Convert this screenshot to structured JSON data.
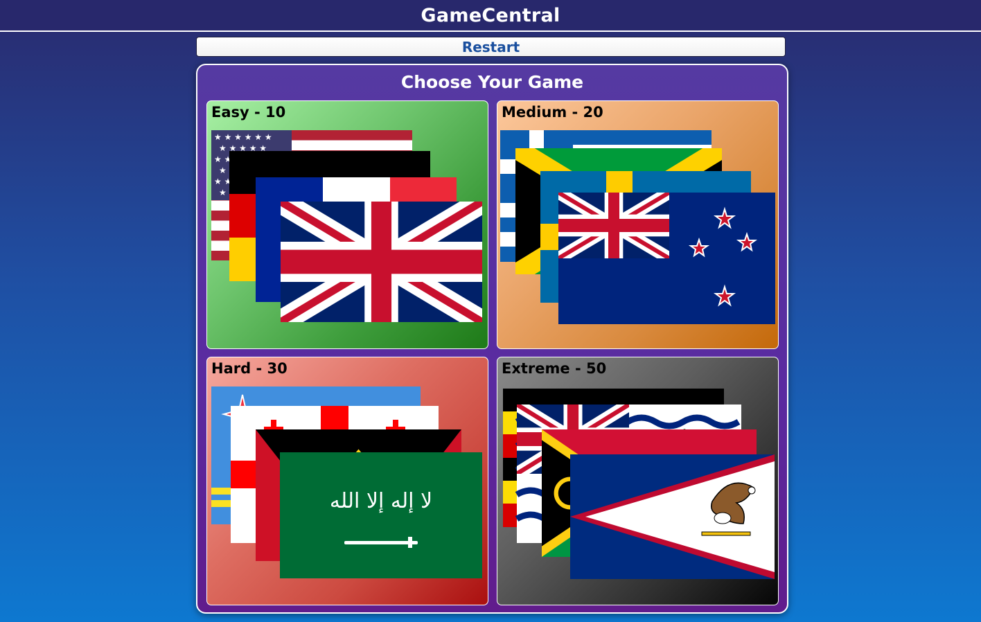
{
  "app": {
    "title": "GameCentral"
  },
  "toolbar": {
    "restart_label": "Restart"
  },
  "main": {
    "heading": "Choose Your Game",
    "modes": [
      {
        "label": "Easy - 10"
      },
      {
        "label": "Medium - 20"
      },
      {
        "label": "Hard - 30"
      },
      {
        "label": "Extreme - 50"
      }
    ]
  },
  "colors": {
    "header_bg": "#28286c",
    "panel_bg": "#553aa2",
    "easy": "#4fae4c",
    "medium": "#e09650",
    "hard": "#cc4a40",
    "extreme": "#3a3a3a"
  }
}
